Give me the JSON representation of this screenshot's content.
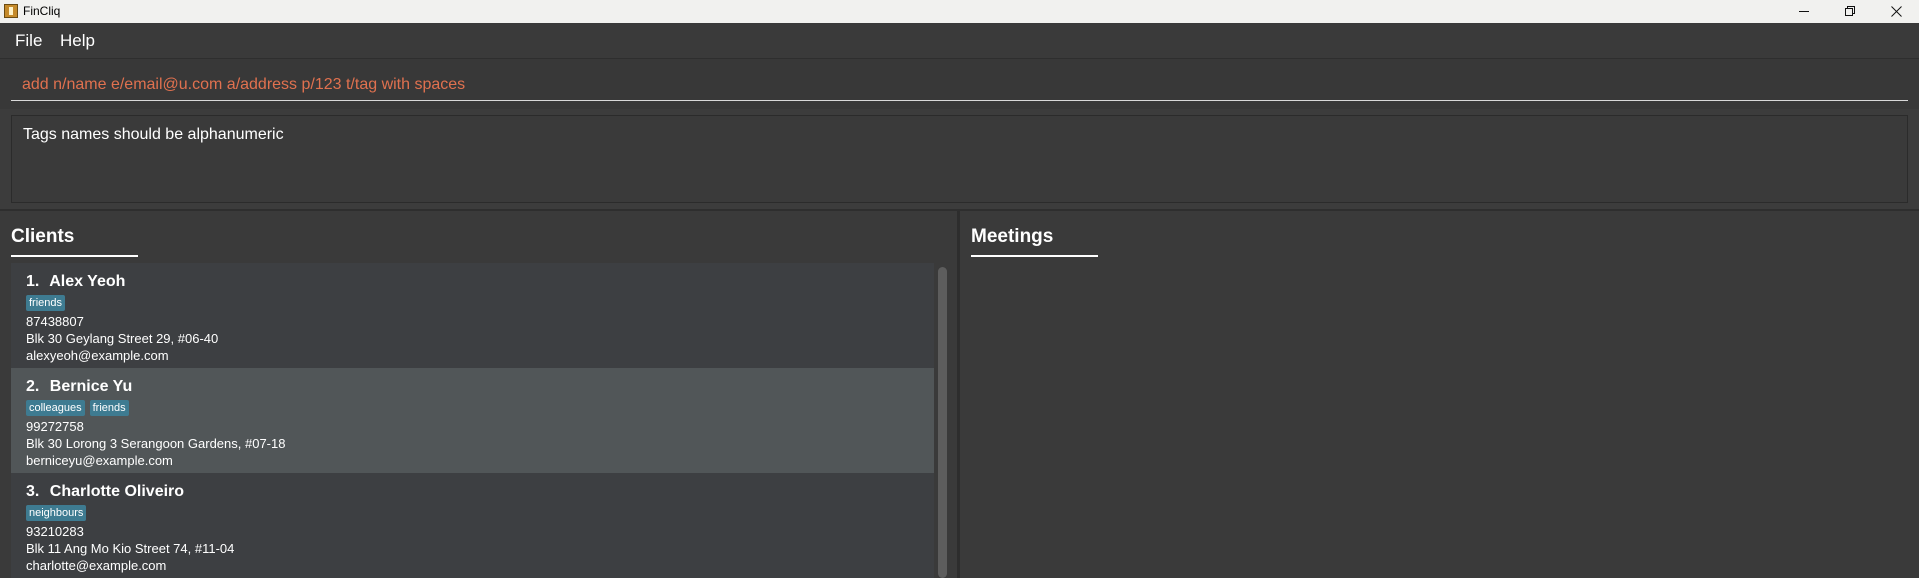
{
  "window": {
    "title": "FinCliq"
  },
  "menu": {
    "file": "File",
    "help": "Help"
  },
  "command": {
    "value": "add n/name e/email@u.com a/address p/123 t/tag with spaces"
  },
  "result": {
    "message": "Tags names should be alphanumeric"
  },
  "clients": {
    "title": "Clients",
    "items": [
      {
        "index": "1.",
        "name": "Alex Yeoh",
        "tags": [
          "friends"
        ],
        "phone": "87438807",
        "address": "Blk 30 Geylang Street 29, #06-40",
        "email": "alexyeoh@example.com"
      },
      {
        "index": "2.",
        "name": "Bernice Yu",
        "tags": [
          "colleagues",
          "friends"
        ],
        "phone": "99272758",
        "address": "Blk 30 Lorong 3 Serangoon Gardens, #07-18",
        "email": "berniceyu@example.com"
      },
      {
        "index": "3.",
        "name": "Charlotte Oliveiro",
        "tags": [
          "neighbours"
        ],
        "phone": "93210283",
        "address": "Blk 11 Ang Mo Kio Street 74, #11-04",
        "email": "charlotte@example.com"
      }
    ]
  },
  "meetings": {
    "title": "Meetings"
  },
  "colors": {
    "error_text": "#e0714f",
    "tag_bg": "#3e7b91",
    "selected_card": "#515658"
  }
}
